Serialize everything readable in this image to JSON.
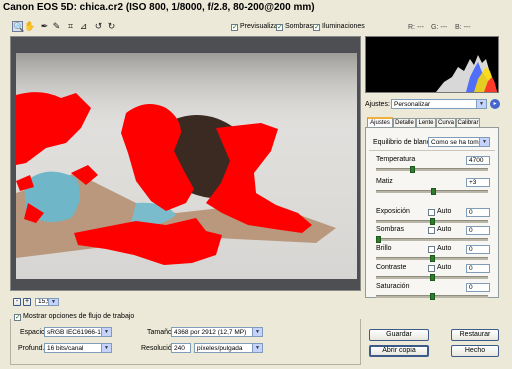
{
  "window": {
    "title": "Canon EOS 5D:  chica.cr2  (ISO 800, 1/8000, f/2.8, 80-200@200 mm)"
  },
  "toolbar": {
    "tools": [
      {
        "name": "zoom-tool",
        "glyph": "🔍"
      },
      {
        "name": "hand-tool",
        "glyph": "✋"
      },
      {
        "name": "white-balance-tool",
        "glyph": "✒"
      },
      {
        "name": "color-sampler-tool",
        "glyph": "✎"
      },
      {
        "name": "crop-tool",
        "glyph": "⌗"
      },
      {
        "name": "straighten-tool",
        "glyph": "⊿"
      },
      {
        "name": "rotate-ccw-tool",
        "glyph": "↺"
      },
      {
        "name": "rotate-cw-tool",
        "glyph": "↻"
      }
    ],
    "preview_label": "Previsualizar",
    "shadows_label": "Sombras",
    "highlights_label": "Iluminaciones",
    "check": "✓"
  },
  "rgb_readout": {
    "r": "R:",
    "g": "G:",
    "b": "B:",
    "r_val": "---",
    "g_val": "---",
    "b_val": "---"
  },
  "zoom": {
    "value": "15,5%",
    "minus": "-",
    "plus": "+"
  },
  "settings": {
    "label": "Ajustes:",
    "value": "Personalizar"
  },
  "tabs": [
    "Ajustes",
    "Detalle",
    "Lente",
    "Curva",
    "Calibrar"
  ],
  "white_balance": {
    "label": "Equilibrio de blancos:",
    "value": "Como se ha tomado"
  },
  "adjustments": [
    {
      "label": "Temperatura",
      "value": "4700",
      "auto": false,
      "level": 0.32
    },
    {
      "label": "Matiz",
      "value": "+3",
      "auto": false,
      "level": 0.51
    },
    {
      "label": "Exposición",
      "value": "0",
      "auto": true,
      "auto_label": "Auto",
      "level": 0.5
    },
    {
      "label": "Sombras",
      "value": "0",
      "auto": true,
      "auto_label": "Auto",
      "level": 0.02
    },
    {
      "label": "Brillo",
      "value": "0",
      "auto": true,
      "auto_label": "Auto",
      "level": 0.5
    },
    {
      "label": "Contraste",
      "value": "0",
      "auto": true,
      "auto_label": "Auto",
      "level": 0.5
    },
    {
      "label": "Saturación",
      "value": "0",
      "auto": false,
      "level": 0.5
    }
  ],
  "workflow": {
    "show_label": "Mostrar opciones de flujo de trabajo",
    "space_label": "Espacio:",
    "space_value": "sRGB IEC61966-1",
    "depth_label": "Profund.:",
    "depth_value": "16 bits/canal",
    "size_label": "Tamaño:",
    "size_value": "4368 por 2912  (12,7 MP)",
    "res_label": "Resolución:",
    "res_value": "240",
    "res_unit": "píxeles/pulgada"
  },
  "buttons": {
    "save": "Guardar",
    "open": "Abrir copia",
    "reset": "Restaurar",
    "done": "Hecho"
  },
  "colors": {
    "clip": "#ff0000",
    "accent": "#f0b040",
    "button_border": "#3c5a8a"
  }
}
